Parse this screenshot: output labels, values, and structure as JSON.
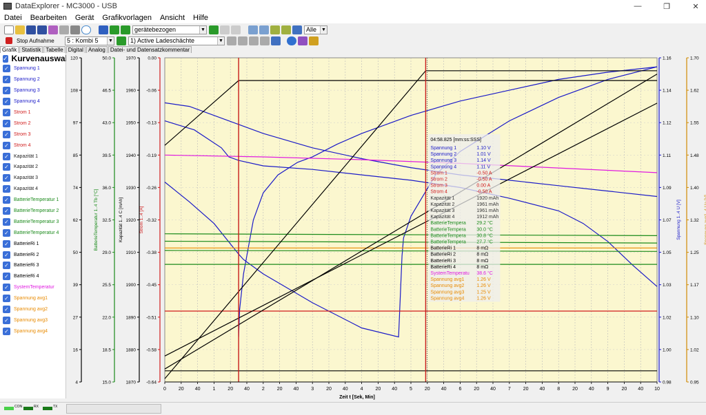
{
  "window": {
    "title": "DataExplorer  -  MC3000  -  USB"
  },
  "menu": [
    "Datei",
    "Bearbeiten",
    "Gerät",
    "Grafikvorlagen",
    "Ansicht",
    "Hilfe"
  ],
  "toolbar": {
    "mode_select": "gerätebezogen",
    "filter_select": "Alle",
    "stop_label": "Stop Aufnahme",
    "device_select": "5 : Kombi 5",
    "channel_select": "1) Active Ladeschächte"
  },
  "tabs": [
    "Grafik",
    "Statistik",
    "Tabelle",
    "Digital",
    "Analog",
    "Datei- und Datensatzkommentar"
  ],
  "sidebar": {
    "title": "Kurvenauswahl",
    "items": [
      {
        "label": "Spannung 1",
        "color": "#1a1ac8"
      },
      {
        "label": "Spannung 2",
        "color": "#1a1ac8"
      },
      {
        "label": "Spannung 3",
        "color": "#1a1ac8"
      },
      {
        "label": "Spannung 4",
        "color": "#1a1ac8"
      },
      {
        "label": "Strom 1",
        "color": "#d01a1a"
      },
      {
        "label": "Strom 2",
        "color": "#d01a1a"
      },
      {
        "label": "Strom 3",
        "color": "#d01a1a"
      },
      {
        "label": "Strom 4",
        "color": "#d01a1a"
      },
      {
        "label": "Kapazität 1",
        "color": "#222222"
      },
      {
        "label": "Kapazität 2",
        "color": "#222222"
      },
      {
        "label": "Kapazität 3",
        "color": "#222222"
      },
      {
        "label": "Kapazität 4",
        "color": "#222222"
      },
      {
        "label": "BatterieTemperatur 1",
        "color": "#1a8a1a"
      },
      {
        "label": "BatterieTemperatur 2",
        "color": "#1a8a1a"
      },
      {
        "label": "BatterieTemperatur 3",
        "color": "#1a8a1a"
      },
      {
        "label": "BatterieTemperatur 4",
        "color": "#1a8a1a"
      },
      {
        "label": "BatterieRi 1",
        "color": "#000000"
      },
      {
        "label": "BatterieRi 2",
        "color": "#000000"
      },
      {
        "label": "BatterieRi 3",
        "color": "#000000"
      },
      {
        "label": "BatterieRi 4",
        "color": "#000000"
      },
      {
        "label": "SystemTemperatur",
        "color": "#e01ae0"
      },
      {
        "label": "Spannung avg1",
        "color": "#e88a00"
      },
      {
        "label": "Spannung avg2",
        "color": "#e88a00"
      },
      {
        "label": "Spannung avg3",
        "color": "#e88a00"
      },
      {
        "label": "Spannung avg4",
        "color": "#e88a00"
      }
    ]
  },
  "statusbar": {
    "con": "CON",
    "rx": "RX",
    "tx": "TX"
  },
  "chart_data": {
    "type": "line",
    "xlabel": "Zeit  t  [Sek, Min]",
    "xticks": [
      "0",
      "20",
      "40",
      "1",
      "20",
      "40",
      "2",
      "20",
      "40",
      "3",
      "20",
      "40",
      "4",
      "20",
      "40",
      "5",
      "20",
      "40",
      "6",
      "20",
      "40",
      "7",
      "20",
      "40",
      "8",
      "20",
      "40",
      "9",
      "20",
      "40",
      "10"
    ],
    "left_axes": [
      {
        "label": "BatterieRi 1..4  r  [mΩ]",
        "color": "#000000",
        "ticks": [
          "120",
          "108",
          "97",
          "85",
          "74",
          "62",
          "50",
          "39",
          "27",
          "16",
          "4"
        ]
      },
      {
        "label": "BatterieTemperatur 1..4  Tb  [°C]",
        "color": "#1a8a1a",
        "ticks": [
          "50.0",
          "46.5",
          "43.0",
          "39.5",
          "36.0",
          "32.5",
          "29.0",
          "25.5",
          "22.0",
          "18.5",
          "15.0"
        ]
      },
      {
        "label": "Kapazität 1..4  C  [mAh]",
        "color": "#000000",
        "ticks": [
          "1970",
          "1960",
          "1950",
          "1940",
          "1930",
          "1920",
          "1910",
          "1900",
          "1890",
          "1880",
          "1870"
        ]
      },
      {
        "label": "Strom 1..4  [A]",
        "color": "#d01a1a",
        "ticks": [
          "0.00",
          "-0.06",
          "-0.13",
          "-0.19",
          "-0.26",
          "-0.32",
          "-0.38",
          "-0.45",
          "-0.51",
          "-0.58",
          "-0.64"
        ]
      }
    ],
    "right_axes": [
      {
        "label": "Spannung 1..4  U  [V]",
        "color": "#1a1ac8",
        "ticks": [
          "1.16",
          "1.14",
          "1.12",
          "1.11",
          "1.09",
          "1.07",
          "1.05",
          "1.03",
          "1.02",
          "1.00",
          "0.98"
        ]
      },
      {
        "label": "Spannung avg1..4  Ua  [V]",
        "color": "#d08a00",
        "ticks": [
          "1.70",
          "1.62",
          "1.55",
          "1.48",
          "1.40",
          "1.32",
          "1.25",
          "1.17",
          "1.10",
          "1.02",
          "0.95"
        ]
      }
    ],
    "cursor": {
      "time": "04:58.825 [mm:ss:SSS]",
      "rows": [
        {
          "name": "Spannung 1",
          "value": "1.10 V",
          "color": "#1a1ac8"
        },
        {
          "name": "Spannung 2",
          "value": "1.01 V",
          "color": "#1a1ac8"
        },
        {
          "name": "Spannung 3",
          "value": "1.14 V",
          "color": "#1a1ac8"
        },
        {
          "name": "Spannung 4",
          "value": "1.11 V",
          "color": "#1a1ac8"
        },
        {
          "name": "Strom 1",
          "value": "-0.50 A",
          "color": "#d01a1a"
        },
        {
          "name": "Strom 2",
          "value": "-0.50 A",
          "color": "#d01a1a"
        },
        {
          "name": "Strom 3",
          "value": "0.00 A",
          "color": "#d01a1a"
        },
        {
          "name": "Strom 4",
          "value": "-0.50 A",
          "color": "#d01a1a"
        },
        {
          "name": "Kapazität 1",
          "value": "1920 mAh",
          "color": "#333333"
        },
        {
          "name": "Kapazität 2",
          "value": "1961 mAh",
          "color": "#333333"
        },
        {
          "name": "Kapazität 3",
          "value": "1961 mAh",
          "color": "#333333"
        },
        {
          "name": "Kapazität 4",
          "value": "1912 mAh",
          "color": "#333333"
        },
        {
          "name": "BatterieTempera",
          "value": "29.2 °C",
          "color": "#1a8a1a"
        },
        {
          "name": "BatterieTempera",
          "value": "30.0 °C",
          "color": "#1a8a1a"
        },
        {
          "name": "BatterieTempera",
          "value": "30.8 °C",
          "color": "#1a8a1a"
        },
        {
          "name": "BatterieTempera",
          "value": "27.7 °C",
          "color": "#1a8a1a"
        },
        {
          "name": "BatterieRi 1",
          "value": "8 mΩ",
          "color": "#000000"
        },
        {
          "name": "BatterieRi 2",
          "value": "8 mΩ",
          "color": "#000000"
        },
        {
          "name": "BatterieRi 3",
          "value": "8 mΩ",
          "color": "#000000"
        },
        {
          "name": "BatterieRi 4",
          "value": "8 mΩ",
          "color": "#000000"
        },
        {
          "name": "SystemTemperatu",
          "value": "38.6 °C",
          "color": "#e01ae0"
        },
        {
          "name": "Spannung avg1",
          "value": "1.26 V",
          "color": "#e88a00"
        },
        {
          "name": "Spannung avg2",
          "value": "1.26 V",
          "color": "#e88a00"
        },
        {
          "name": "Spannung avg3",
          "value": "1.25 V",
          "color": "#e88a00"
        },
        {
          "name": "Spannung avg4",
          "value": "1.26 V",
          "color": "#e88a00"
        }
      ]
    },
    "series": [
      {
        "name": "Spannung 1",
        "axis": "Spannung 1..4  U  [V]",
        "color": "#1a1ac8",
        "x": [
          0,
          0.6,
          1.15,
          1.3,
          1.5,
          2,
          3,
          4,
          5,
          6,
          7,
          8,
          8.5,
          9,
          9.5,
          10
        ],
        "y": [
          1.125,
          1.12,
          1.11,
          1.105,
          1.103,
          1.1,
          1.098,
          1.095,
          1.092,
          1.088,
          1.082,
          1.075,
          1.068,
          1.058,
          1.045,
          1.033
        ]
      },
      {
        "name": "Spannung 2",
        "axis": "Spannung 1..4  U  [V]",
        "color": "#1a1ac8",
        "x": [
          0,
          0.5,
          1,
          1.5,
          1.6,
          2,
          3,
          4,
          4.75,
          4.82,
          4.85,
          5,
          5.5,
          6,
          7,
          8,
          9,
          10
        ],
        "y": [
          1.091,
          1.08,
          1.068,
          1.051,
          1.048,
          1.04,
          1.024,
          1.01,
          1.005,
          1.05,
          1.06,
          1.072,
          1.095,
          1.108,
          1.125,
          1.138,
          1.148,
          1.155
        ]
      },
      {
        "name": "Spannung 3",
        "axis": "Spannung 1..4  U  [V]",
        "color": "#1a1ac8",
        "x": [
          0,
          0.5,
          1,
          1.5,
          2,
          3,
          4,
          5,
          6,
          7,
          8,
          9,
          10
        ],
        "y": [
          1.135,
          1.133,
          1.128,
          1.123,
          1.118,
          1.11,
          1.104,
          1.099,
          1.095,
          1.092,
          1.089,
          1.086,
          1.083
        ]
      },
      {
        "name": "Spannung 4",
        "axis": "Spannung 1..4  U  [V]",
        "color": "#1a1ac8",
        "x": [
          1.5,
          1.52,
          1.6,
          1.8,
          2,
          2.3,
          2.7,
          3,
          3.5,
          4,
          5,
          6,
          7,
          8,
          9,
          10
        ],
        "y": [
          1.005,
          1.02,
          1.04,
          1.07,
          1.085,
          1.095,
          1.102,
          1.105,
          1.112,
          1.118,
          1.128,
          1.136,
          1.142,
          1.148,
          1.152,
          1.155
        ]
      },
      {
        "name": "Strom",
        "axis": "Strom 1..4  [A]",
        "color": "#d01a1a",
        "x": [
          0,
          10
        ],
        "y": [
          -0.5,
          -0.5
        ]
      },
      {
        "name": "SystemTemperatur",
        "axis": "BatterieTemperatur 1..4  Tb  [°C]",
        "color": "#e01ae0",
        "x": [
          0,
          2,
          4,
          6,
          8,
          10
        ],
        "y": [
          39.5,
          39.3,
          39.0,
          38.6,
          38.1,
          37.6
        ]
      },
      {
        "name": "BatterieTemperatur 1",
        "axis": "BatterieTemperatur 1..4  Tb  [°C]",
        "color": "#1a8a1a",
        "x": [
          0,
          10
        ],
        "y": [
          31.0,
          30.8
        ]
      },
      {
        "name": "BatterieTemperatur 2",
        "axis": "BatterieTemperatur 1..4  Tb  [°C]",
        "color": "#1a8a1a",
        "x": [
          0,
          10
        ],
        "y": [
          30.2,
          30.0
        ]
      },
      {
        "name": "BatterieTemperatur 3",
        "axis": "BatterieTemperatur 1..4  Tb  [°C]",
        "color": "#1a8a1a",
        "x": [
          0,
          10
        ],
        "y": [
          29.2,
          29.1
        ]
      },
      {
        "name": "BatterieTemperatur 4",
        "axis": "BatterieTemperatur 1..4  Tb  [°C]",
        "color": "#1a8a1a",
        "x": [
          0,
          10
        ],
        "y": [
          27.7,
          27.7
        ]
      },
      {
        "name": "Spannung avg",
        "axis": "Spannung avg1..4  Ua  [V]",
        "color": "#e88a00",
        "x": [
          0,
          10
        ],
        "y": [
          1.26,
          1.26
        ]
      },
      {
        "name": "Kapazität 1",
        "axis": "Kapazität 1..4  C  [mAh]",
        "color": "#000000",
        "x": [
          0,
          1.5,
          10
        ],
        "y": [
          1943,
          1963,
          1963
        ]
      },
      {
        "name": "Kapazität 2",
        "axis": "Kapazität 1..4  C  [mAh]",
        "color": "#000000",
        "x": [
          0,
          5.3,
          10
        ],
        "y": [
          1871,
          1966,
          1966
        ]
      },
      {
        "name": "Kapazität 3",
        "axis": "Kapazität 1..4  C  [mAh]",
        "color": "#000000",
        "x": [
          0,
          10
        ],
        "y": [
          1874,
          1965
        ]
      },
      {
        "name": "Kapazität 4",
        "axis": "Kapazität 1..4  C  [mAh]",
        "color": "#000000",
        "x": [
          0,
          10
        ],
        "y": [
          1878,
          1956
        ]
      },
      {
        "name": "BatterieRi",
        "axis": "BatterieRi 1..4  r  [mΩ]",
        "color": "#000000",
        "x": [
          0,
          10
        ],
        "y": [
          8,
          8
        ]
      }
    ],
    "markers": [
      1.5,
      5.3
    ]
  }
}
